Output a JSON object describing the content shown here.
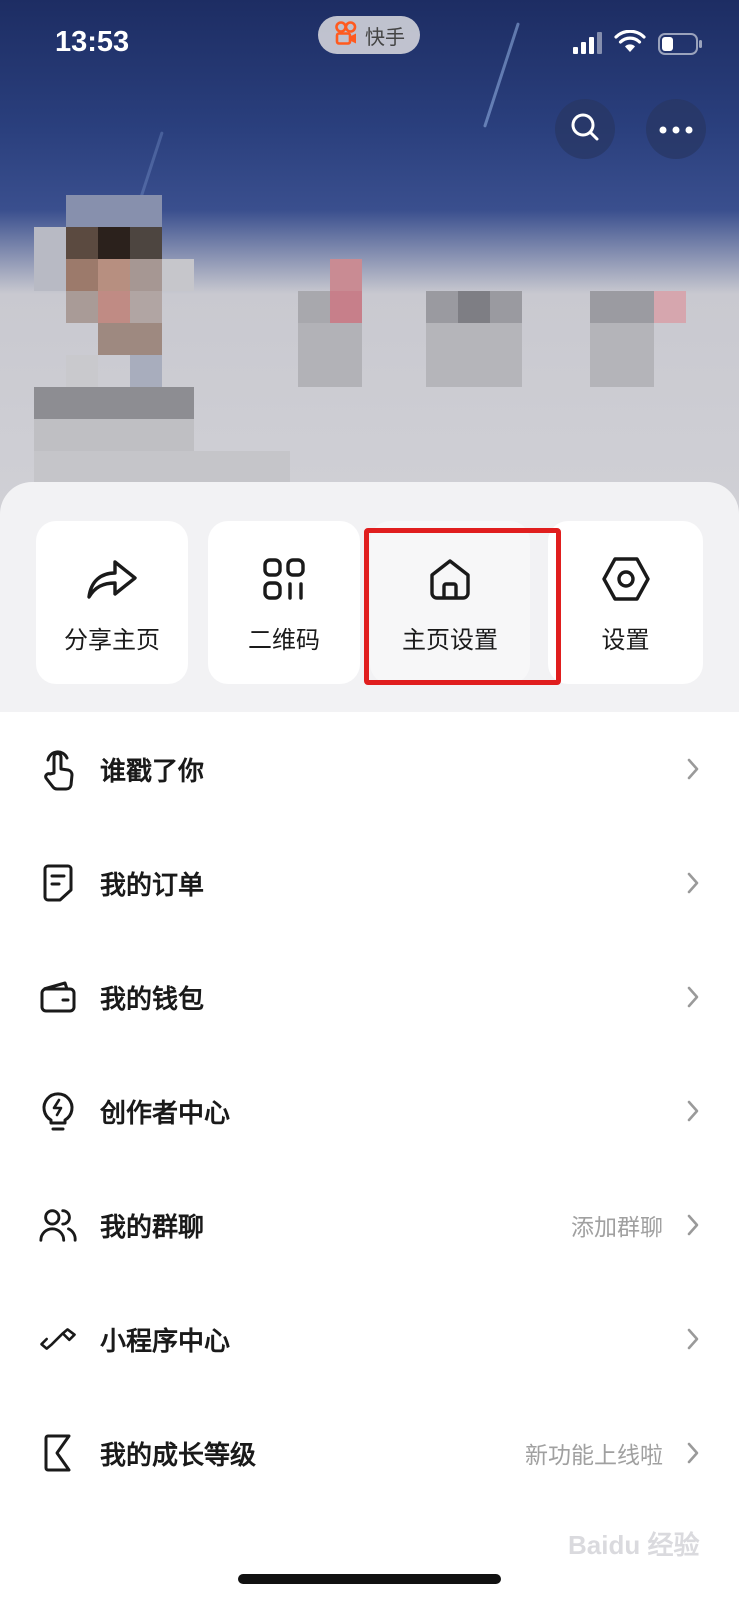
{
  "status_bar": {
    "time": "13:53",
    "app_name": "快手"
  },
  "header": {
    "search_icon": "search-icon",
    "more_icon": "more-icon"
  },
  "quick_actions": [
    {
      "label": "分享主页",
      "icon": "share-icon"
    },
    {
      "label": "二维码",
      "icon": "qrcode-icon"
    },
    {
      "label": "主页设置",
      "icon": "home-icon",
      "highlighted": true
    },
    {
      "label": "设置",
      "icon": "settings-hexagon-icon"
    }
  ],
  "menu": [
    {
      "label": "谁戳了你",
      "icon": "tap-hand-icon",
      "sub": ""
    },
    {
      "label": "我的订单",
      "icon": "order-doc-icon",
      "sub": ""
    },
    {
      "label": "我的钱包",
      "icon": "wallet-icon",
      "sub": ""
    },
    {
      "label": "创作者中心",
      "icon": "lightbulb-icon",
      "sub": ""
    },
    {
      "label": "我的群聊",
      "icon": "group-users-icon",
      "sub": "添加群聊"
    },
    {
      "label": "小程序中心",
      "icon": "infinity-icon",
      "sub": ""
    },
    {
      "label": "我的成长等级",
      "icon": "k-level-icon",
      "sub": "新功能上线啦"
    }
  ],
  "watermark": "Baidu 经验",
  "colors": {
    "highlight": "#e01e1e",
    "header_top": "#1d2d63",
    "app_logo": "#ff5a1f"
  }
}
